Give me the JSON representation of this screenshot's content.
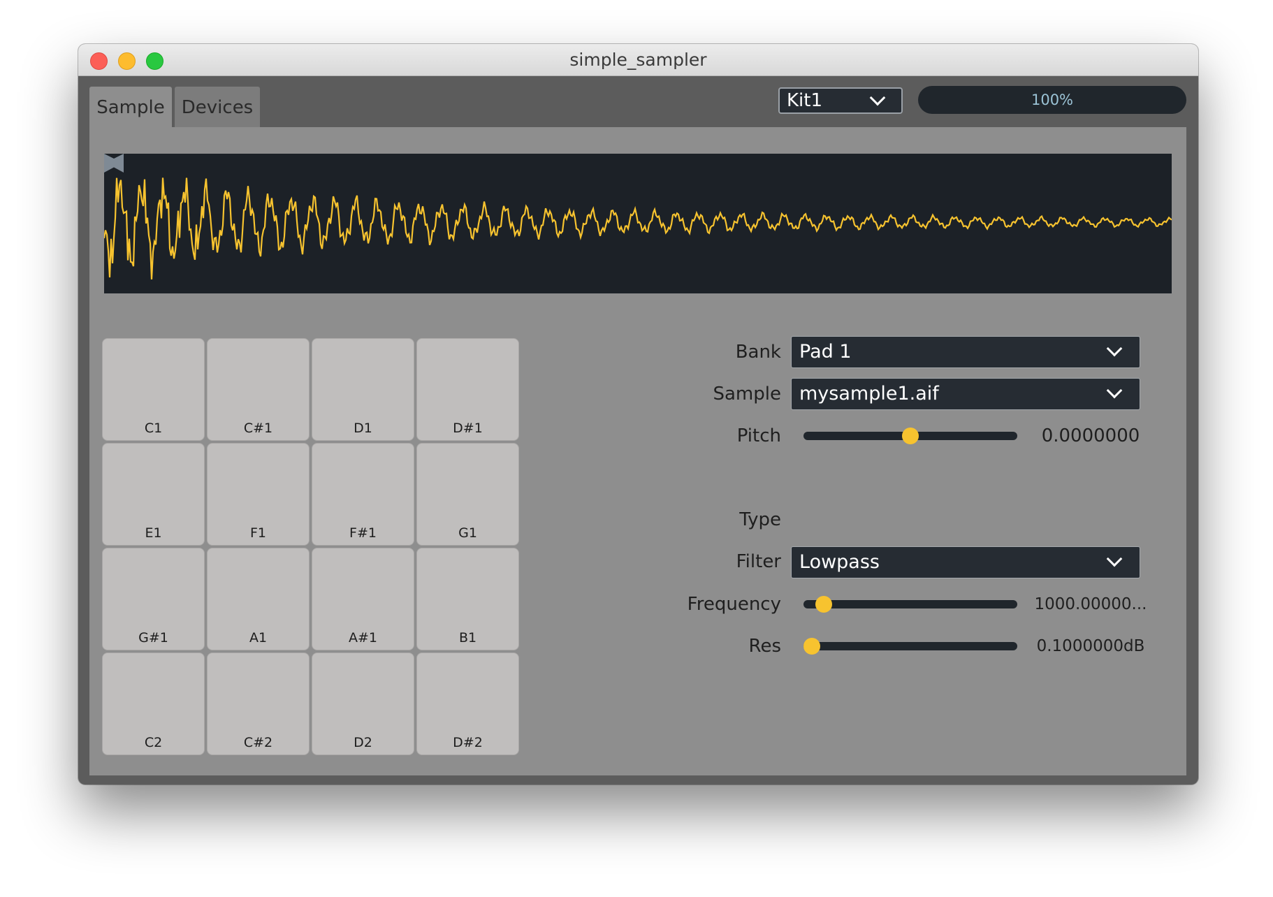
{
  "window": {
    "title": "simple_sampler"
  },
  "tabs": [
    {
      "label": "Sample",
      "active": true
    },
    {
      "label": "Devices",
      "active": false
    }
  ],
  "kit": {
    "selected": "Kit1"
  },
  "level_meter": {
    "text": "100%"
  },
  "waveform": {
    "color": "#f7c32f",
    "background": "#1c2127"
  },
  "pads": [
    [
      "C1",
      "C#1",
      "D1",
      "D#1"
    ],
    [
      "E1",
      "F1",
      "F#1",
      "G1"
    ],
    [
      "G#1",
      "A1",
      "A#1",
      "B1"
    ],
    [
      "C2",
      "C#2",
      "D2",
      "D#2"
    ]
  ],
  "controls": {
    "bank": {
      "label": "Bank",
      "value": "Pad 1"
    },
    "sample": {
      "label": "Sample",
      "value": "mysample1.aif"
    },
    "pitch": {
      "label": "Pitch",
      "value": "0.0000000",
      "position": 0.5
    },
    "type": {
      "label": "Type",
      "checked": false
    },
    "filter": {
      "label": "Filter",
      "value": "Lowpass"
    },
    "frequency": {
      "label": "Frequency",
      "value": "1000.00000...",
      "position": 0.06
    },
    "res": {
      "label": "Res",
      "value": "0.1000000dB",
      "position": 0.0
    }
  },
  "colors": {
    "accent": "#f7c32f",
    "control_dark": "#262c33",
    "panel": "#8e8e8e",
    "pad": "#c0bebd"
  }
}
